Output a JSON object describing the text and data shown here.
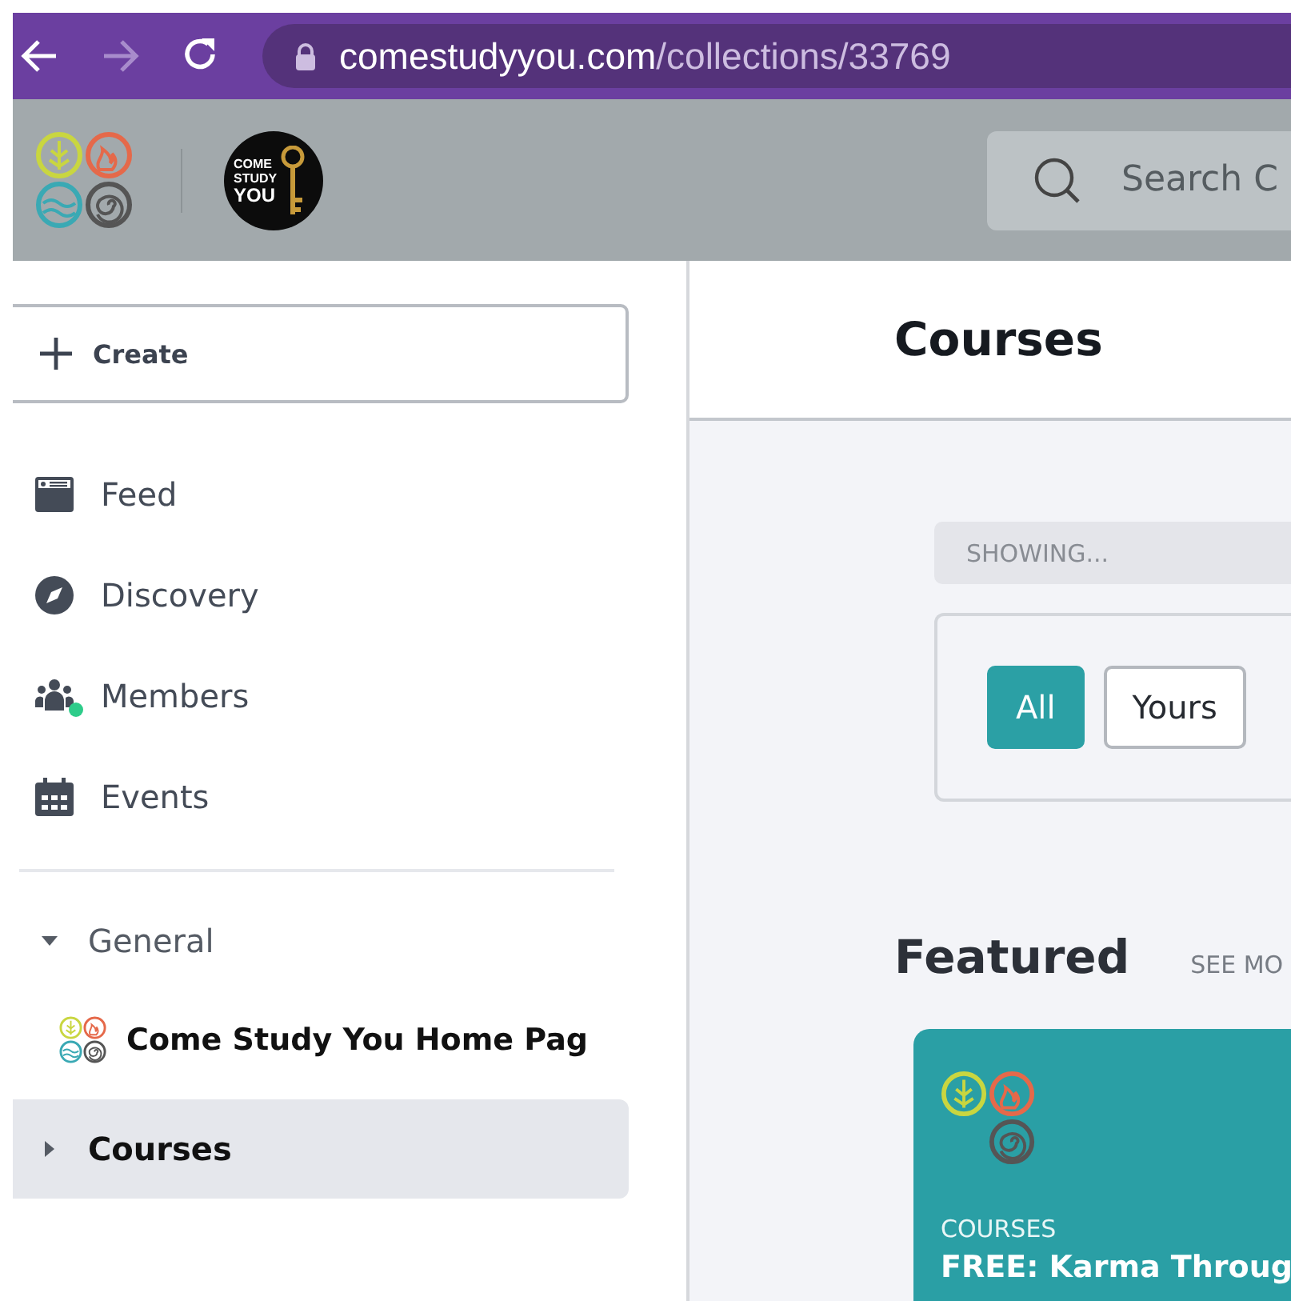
{
  "browser": {
    "url_host": "comestudyyou.com",
    "url_path": "/collections/33769"
  },
  "header": {
    "brand_text": [
      "COME",
      "STUDY",
      "YOU"
    ],
    "search": {
      "placeholder": "Search C"
    }
  },
  "sidebar": {
    "create_button": "Create",
    "nav": [
      {
        "label": "Feed",
        "badge": false
      },
      {
        "label": "Discovery",
        "badge": false
      },
      {
        "label": "Members",
        "badge": true
      },
      {
        "label": "Events",
        "badge": false
      }
    ],
    "sections": [
      {
        "label": "General",
        "expanded": true,
        "selected": false,
        "children": [
          {
            "label": "Come Study You Home Pag"
          }
        ]
      },
      {
        "label": "Courses",
        "expanded": false,
        "selected": true
      }
    ]
  },
  "main": {
    "title": "Courses",
    "showing_label": "SHOWING...",
    "filters": [
      {
        "label": "All",
        "selected": true
      },
      {
        "label": "Yours",
        "selected": false
      }
    ],
    "featured": {
      "heading": "Featured",
      "see_more": "SEE MO",
      "card": {
        "category": "COURSES",
        "title": "FREE: Karma Throug"
      }
    }
  }
}
